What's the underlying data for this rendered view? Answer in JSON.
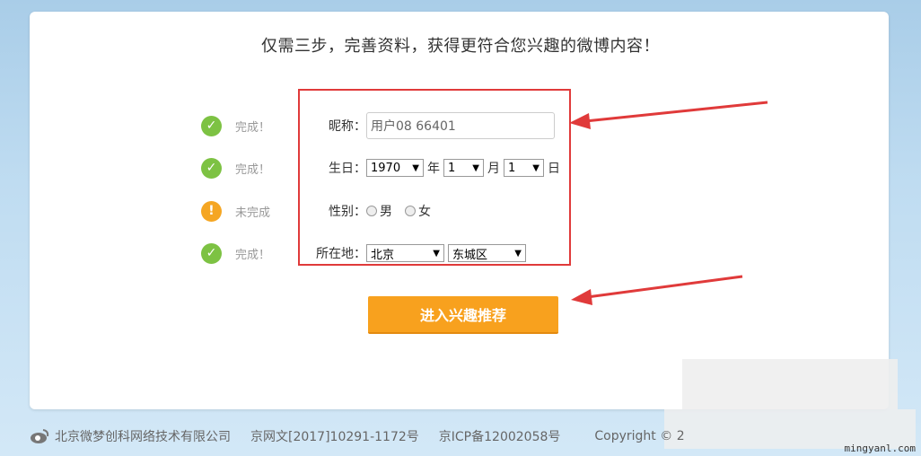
{
  "header": {
    "title": "仅需三步，完善资料，获得更符合您兴趣的微博内容！"
  },
  "steps": [
    {
      "status": "完成！",
      "icon": "check-icon",
      "state": "complete"
    },
    {
      "status": "完成！",
      "icon": "check-icon",
      "state": "complete"
    },
    {
      "status": "未完成",
      "icon": "exclamation-icon",
      "state": "incomplete"
    },
    {
      "status": "完成！",
      "icon": "check-icon",
      "state": "complete"
    }
  ],
  "form": {
    "nickname_label": "昵称：",
    "nickname_value": "用户08 66401",
    "birthday_label": "生日：",
    "year": "1970",
    "year_unit": "年",
    "month": "1",
    "month_unit": "月",
    "day": "1",
    "day_unit": "日",
    "gender_label": "性别：",
    "male": "男",
    "female": "女",
    "location_label": "所在地：",
    "province": "北京",
    "district": "东城区"
  },
  "submit_label": "进入兴趣推荐",
  "footer": {
    "company": "北京微梦创科网络技术有限公司",
    "license1": "京网文[2017]10291-1172号",
    "license2": "京ICP备12002058号",
    "copyright": "Copyright © 2"
  },
  "watermark": "mingyanl.com",
  "colors": {
    "accent": "#f8a11e",
    "ok": "#7dc243",
    "warn": "#f5a623",
    "annotation": "#e03a3a"
  }
}
